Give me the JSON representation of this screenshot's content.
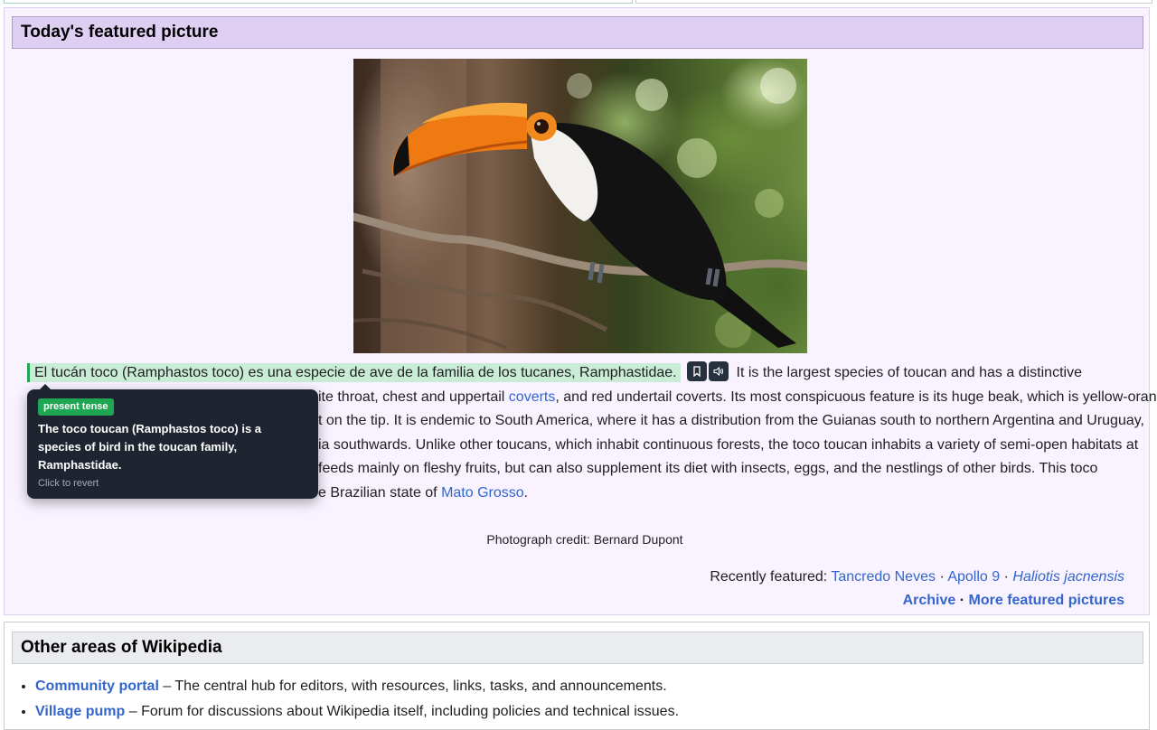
{
  "featured": {
    "heading": "Today's featured picture",
    "paragraph": {
      "highlighted_sentence": "El tucán toco (Ramphastos toco) es una especie de ave de la familia de los tucanes, Ramphastidae.",
      "line1_rest": "It is the largest species of toucan and has a distinctive",
      "line2_pre": "ite throat, chest and uppertail ",
      "line2_link": "coverts",
      "line2_post": ", and red undertail coverts. Its most conspicuous feature is its huge beak, which is yellow-orange",
      "line3": "t on the tip. It is endemic to South America, where it has a distribution from the Guianas south to northern Argentina and Uruguay,",
      "line4": "ia southwards. Unlike other toucans, which inhabit continuous forests, the toco toucan inhabits a variety of semi-open habitats at",
      "line5": "feeds mainly on fleshy fruits, but can also supplement its diet with insects, eggs, and the nestlings of other birds. This toco",
      "line6_pre": "e Brazilian state of ",
      "line6_link": "Mato Grosso",
      "line6_post": "."
    },
    "icons": {
      "save": "bookmark-icon",
      "listen": "speaker-icon"
    },
    "tooltip": {
      "badge": "present tense",
      "text": "The toco toucan (Ramphastos toco) is a species of bird in the toucan family, Ramphastidae.",
      "hint": "Click to revert"
    },
    "credit": "Photograph credit: Bernard Dupont",
    "recently_label": "Recently featured:",
    "recent_links": [
      "Tancredo Neves",
      "Apollo 9",
      "Haliotis jacnensis"
    ],
    "archive_link": "Archive",
    "more_link": "More featured pictures"
  },
  "other_areas": {
    "heading": "Other areas of Wikipedia",
    "items": [
      {
        "link": "Community portal",
        "desc": " – The central hub for editors, with resources, links, tasks, and announcements."
      },
      {
        "link": "Village pump",
        "desc": " – Forum for discussions about Wikipedia itself, including policies and technical issues."
      }
    ]
  },
  "colors": {
    "box_bg": "#f9f2ff",
    "header_bg": "#ddcef2",
    "highlight": "#c8ecd6",
    "badge": "#1fa653",
    "tooltip_bg": "#1f2530",
    "link": "#3366cc"
  }
}
